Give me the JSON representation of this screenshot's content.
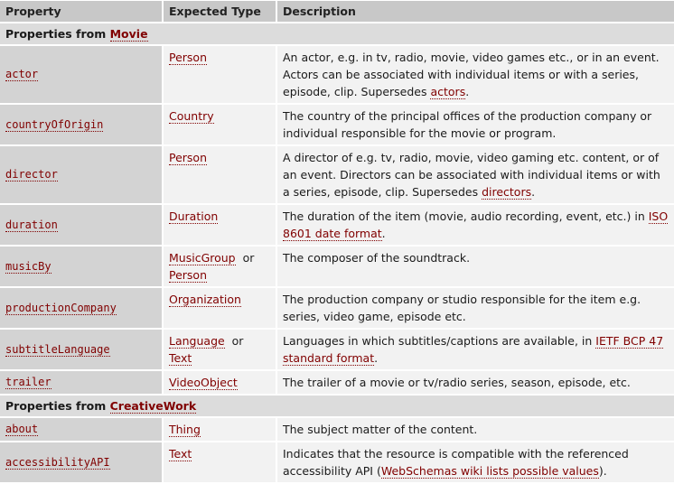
{
  "headers": {
    "property": "Property",
    "expected_type": "Expected Type",
    "description": "Description"
  },
  "sections": [
    {
      "prefix": "Properties from",
      "link": "Movie"
    },
    {
      "prefix": "Properties from",
      "link": "CreativeWork"
    }
  ],
  "or_word": "or",
  "rows": {
    "actor": {
      "name": "actor",
      "type": "Person",
      "desc": "An actor, e.g. in tv, radio, movie, video games etc., or in an event. Actors can be associated with individual items or with a series, episode, clip. Supersedes ",
      "desc_link": "actors",
      "desc_end": "."
    },
    "countryOfOrigin": {
      "name": "countryOfOrigin",
      "type": "Country",
      "desc": "The country of the principal offices of the production company or individual responsible for the movie or program."
    },
    "director": {
      "name": "director",
      "type": "Person",
      "desc": "A director of e.g. tv, radio, movie, video gaming etc. content, or of an event. Directors can be associated with individual items or with a series, episode, clip. Supersedes ",
      "desc_link": "directors",
      "desc_end": "."
    },
    "duration": {
      "name": "duration",
      "type": "Duration",
      "desc": "The duration of the item (movie, audio recording, event, etc.) in ",
      "desc_link": "ISO 8601 date format",
      "desc_end": "."
    },
    "musicBy": {
      "name": "musicBy",
      "type1": "MusicGroup",
      "type2": "Person",
      "desc": "The composer of the soundtrack."
    },
    "productionCompany": {
      "name": "productionCompany",
      "type": "Organization",
      "desc": "The production company or studio responsible for the item e.g. series, video game, episode etc."
    },
    "subtitleLanguage": {
      "name": "subtitleLanguage",
      "type1": "Language",
      "type2": "Text",
      "desc": "Languages in which subtitles/captions are available, in ",
      "desc_link": "IETF BCP 47 standard format",
      "desc_end": "."
    },
    "trailer": {
      "name": "trailer",
      "type": "VideoObject",
      "desc": "The trailer of a movie or tv/radio series, season, episode, etc."
    },
    "about": {
      "name": "about",
      "type": "Thing",
      "desc": "The subject matter of the content."
    },
    "accessibilityAPI": {
      "name": "accessibilityAPI",
      "type": "Text",
      "desc": "Indicates that the resource is compatible with the referenced accessibility API (",
      "desc_link": "WebSchemas wiki lists possible values",
      "desc_end": ")."
    }
  }
}
